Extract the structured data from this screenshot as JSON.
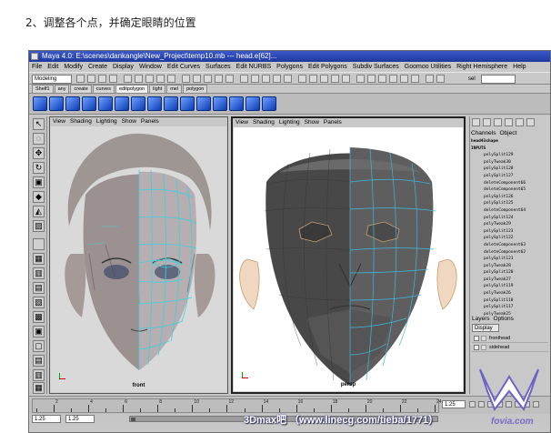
{
  "caption": "2、调整各个点，并确定眼睛的位置",
  "window": {
    "title": "Maya 4.0: E:\\scenes\\dankangle\\New_Project\\temp10.mb   ---   head.e[62]..."
  },
  "menubar": [
    "File",
    "Edit",
    "Modify",
    "Create",
    "Display",
    "Window",
    "Edit Curves",
    "Surfaces",
    "Edit NURBS",
    "Polygons",
    "Edit Polygons",
    "Subdiv Surfaces",
    "Goomoo Utilities",
    "Right Hemisphere",
    "Help"
  ],
  "statusline": {
    "mode": "Modeling",
    "sel_label": "sel"
  },
  "shelf_tabs": [
    "Shelf1",
    "any",
    "create",
    "curves",
    "editpolygon",
    "light",
    "mel",
    "polygon"
  ],
  "viewports": {
    "front": {
      "menu": [
        "View",
        "Shading",
        "Lighting",
        "Show",
        "Panels"
      ],
      "label": "front"
    },
    "persp": {
      "menu": [
        "View",
        "Shading",
        "Lighting",
        "Show",
        "Panels"
      ],
      "label": "persp"
    }
  },
  "channels": {
    "tabs": [
      "Channels",
      "Object"
    ],
    "object": "head43shape",
    "inputs_header": "INPUTS",
    "inputs": [
      "polySplit129",
      "polyTweak30",
      "polySplit128",
      "polySplit127",
      "deleteComponent66",
      "deleteComponent65",
      "polySplit126",
      "polySplit125",
      "deleteComponent64",
      "polySplit124",
      "polyTweak29",
      "polySplit123",
      "polySplit122",
      "deleteComponent63",
      "deleteComponent62",
      "polySplit121",
      "polyTweak28",
      "polySplit120",
      "polyTweak27",
      "polySplit119",
      "polyTweak26",
      "polySplit118",
      "polySplit117",
      "polyTweak25"
    ]
  },
  "layers": {
    "menu": [
      "Layers",
      "Options"
    ],
    "display": "Display",
    "items": [
      "fronthead",
      "sidehead"
    ]
  },
  "timeline": {
    "ticks": [
      "2",
      "4",
      "6",
      "8",
      "10",
      "12",
      "14",
      "16",
      "18",
      "20",
      "22",
      "24"
    ],
    "current_time": "1.25"
  },
  "range": {
    "start": "1.25",
    "inner_start": "1.25"
  },
  "watermark": {
    "text": "3Dmax吧 （www.linecg.com/tieba/1771）",
    "site": "fovia.com"
  }
}
